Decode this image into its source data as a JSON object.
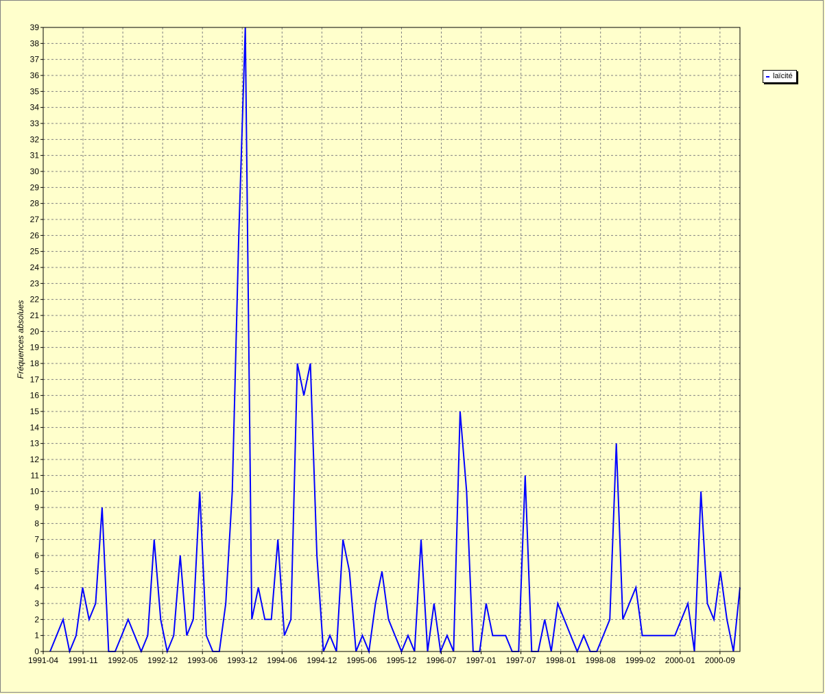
{
  "chart_data": {
    "type": "line",
    "title": "",
    "xlabel": "",
    "ylabel": "Fréquences absolues",
    "ylim": [
      0,
      39
    ],
    "grid": true,
    "legend_position": "top-right",
    "x_tick_labels": [
      "1991-04",
      "1991-11",
      "1992-05",
      "1992-12",
      "1993-06",
      "1993-12",
      "1994-06",
      "1994-12",
      "1995-06",
      "1995-12",
      "1996-07",
      "1997-01",
      "1997-07",
      "1998-01",
      "1998-08",
      "1999-02",
      "2000-01",
      "2000-09"
    ],
    "y_ticks": [
      0,
      1,
      2,
      3,
      4,
      5,
      6,
      7,
      8,
      9,
      10,
      11,
      12,
      13,
      14,
      15,
      16,
      17,
      18,
      19,
      20,
      21,
      22,
      23,
      24,
      25,
      26,
      27,
      28,
      29,
      30,
      31,
      32,
      33,
      34,
      35,
      36,
      37,
      38,
      39
    ],
    "series": [
      {
        "name": "laïcité",
        "color": "#0000ff",
        "values": [
          0,
          1,
          2,
          0,
          1,
          4,
          2,
          3,
          9,
          0,
          0,
          1,
          2,
          1,
          0,
          1,
          7,
          2,
          0,
          1,
          6,
          1,
          2,
          10,
          1,
          0,
          0,
          3,
          10,
          26,
          39,
          2,
          4,
          2,
          2,
          7,
          1,
          2,
          18,
          16,
          18,
          6,
          0,
          1,
          0,
          7,
          5,
          0,
          1,
          0,
          3,
          5,
          2,
          1,
          0,
          1,
          0,
          7,
          0,
          3,
          0,
          1,
          0,
          15,
          10,
          0,
          0,
          3,
          1,
          1,
          1,
          0,
          0,
          11,
          0,
          0,
          2,
          0,
          3,
          2,
          1,
          0,
          1,
          0,
          0,
          1,
          2,
          13,
          2,
          3,
          4,
          1,
          1,
          1,
          1,
          1,
          1,
          2,
          3,
          0,
          10,
          3,
          2,
          5,
          2,
          0,
          4
        ]
      }
    ]
  }
}
